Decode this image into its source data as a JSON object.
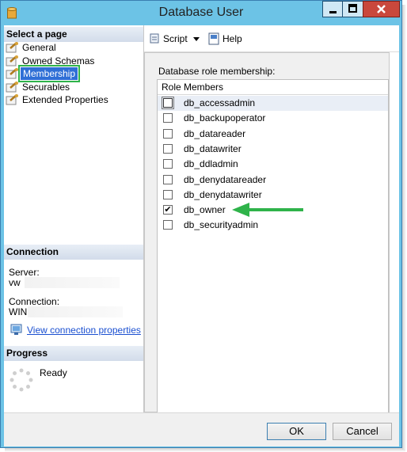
{
  "window": {
    "title": "Database User",
    "controls": [
      "minimize-icon",
      "maximize-icon",
      "close-icon"
    ]
  },
  "left": {
    "select_page_header": "Select a page",
    "pages": [
      {
        "label": "General"
      },
      {
        "label": "Owned Schemas"
      },
      {
        "label": "Membership",
        "selected": true
      },
      {
        "label": "Securables"
      },
      {
        "label": "Extended Properties"
      }
    ],
    "connection_header": "Connection",
    "server_label": "Server:",
    "server_value": "vw",
    "connection_label": "Connection:",
    "connection_value": "WIN",
    "view_props_link": "View connection properties",
    "progress_header": "Progress",
    "progress_status": "Ready"
  },
  "toolbar": {
    "script_label": "Script",
    "help_label": "Help"
  },
  "main": {
    "group_label": "Database role membership:",
    "column_header": "Role Members",
    "roles": [
      {
        "name": "db_accessadmin",
        "checked": false
      },
      {
        "name": "db_backupoperator",
        "checked": false
      },
      {
        "name": "db_datareader",
        "checked": false
      },
      {
        "name": "db_datawriter",
        "checked": false
      },
      {
        "name": "db_ddladmin",
        "checked": false
      },
      {
        "name": "db_denydatareader",
        "checked": false
      },
      {
        "name": "db_denydatawriter",
        "checked": false
      },
      {
        "name": "db_owner",
        "checked": true
      },
      {
        "name": "db_securityadmin",
        "checked": false
      }
    ]
  },
  "footer": {
    "ok_label": "OK",
    "cancel_label": "Cancel"
  },
  "colors": {
    "title_bar": "#6cc3e6",
    "selection": "#2f6fd6",
    "highlight_box": "#2fb34a",
    "arrow": "#2fb34a",
    "link": "#1a4fd0"
  }
}
